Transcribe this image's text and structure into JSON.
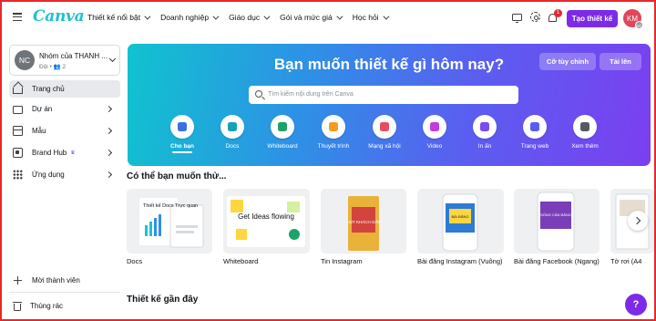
{
  "header": {
    "logo": "Canva",
    "nav": [
      "Thiết kế nổi bật",
      "Doanh nghiệp",
      "Giáo dục",
      "Gói và mức giá",
      "Học hỏi"
    ],
    "notification_count": "1",
    "create_label": "Tạo thiết kế",
    "avatar_initials": "KM",
    "avatar_small": "NC"
  },
  "sidebar": {
    "team": {
      "initials": "NC",
      "name": "Nhóm của THANH ...",
      "sub": "Đội • 👥 2"
    },
    "items": [
      {
        "label": "Trang chủ",
        "icon": "home-icon"
      },
      {
        "label": "Dự án",
        "icon": "folder-icon"
      },
      {
        "label": "Mẫu",
        "icon": "template-icon"
      },
      {
        "label": "Brand Hub",
        "icon": "brand-hub-icon"
      },
      {
        "label": "Ứng dụng",
        "icon": "apps-icon"
      }
    ],
    "bottom": [
      {
        "label": "Mời thành viên",
        "icon": "plus-icon"
      },
      {
        "label": "Thùng rác",
        "icon": "trash-icon"
      }
    ]
  },
  "hero": {
    "title": "Bạn muốn thiết kế gì hôm nay?",
    "custom_size_label": "Cỡ tùy chỉnh",
    "upload_label": "Tải lên",
    "search_placeholder": "Tìm kiếm nội dung trên Canva",
    "categories": [
      {
        "label": "Cho bạn",
        "color": "#3b6fe0"
      },
      {
        "label": "Docs",
        "color": "#13a3b5"
      },
      {
        "label": "Whiteboard",
        "color": "#1aa36a"
      },
      {
        "label": "Thuyết trình",
        "color": "#f59a23"
      },
      {
        "label": "Mạng xã hội",
        "color": "#e84a5f"
      },
      {
        "label": "Video",
        "color": "#c63bd6"
      },
      {
        "label": "In ấn",
        "color": "#7d4cf0"
      },
      {
        "label": "Trang web",
        "color": "#5a5ef0"
      },
      {
        "label": "Xem thêm",
        "color": "#555a62"
      }
    ]
  },
  "suggestions": {
    "title": "Có thể bạn muốn thử...",
    "cards": [
      {
        "label": "Docs",
        "thumb_text": "Thiết kế Docs Trực quan"
      },
      {
        "label": "Whiteboard",
        "thumb_text": "Get Ideas flowing"
      },
      {
        "label": "Tin Instagram",
        "thumb_text": "HÚT KHÁCH GẤP"
      },
      {
        "label": "Bài đăng Instagram (Vuông)",
        "thumb_text": "BÀI ĐĂNG"
      },
      {
        "label": "Bài đăng Facebook (Ngang)",
        "thumb_text": "SỐNG CÂN BẰNG"
      },
      {
        "label": "Tờ rơi (A4",
        "thumb_text": ""
      }
    ]
  },
  "recent": {
    "title": "Thiết kế gần đây"
  },
  "help": {
    "label": "?"
  },
  "colors": {
    "accent": "#7d2ae8",
    "logo": "#1ec2cf",
    "border": "#e8262b"
  }
}
